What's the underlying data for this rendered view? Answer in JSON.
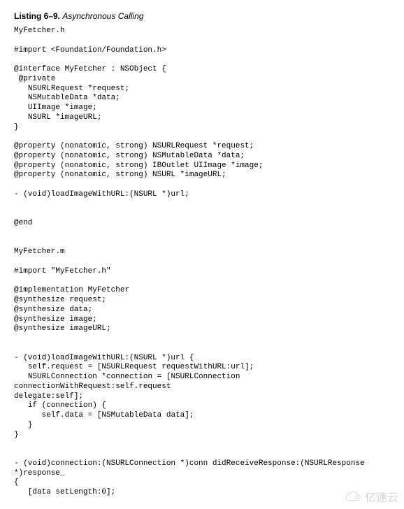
{
  "header": {
    "listing_number": "Listing 6–9.",
    "listing_title": "Asynchronous Calling"
  },
  "code_block": "MyFetcher.h\n\n#import <Foundation/Foundation.h>\n\n@interface MyFetcher : NSObject {\n @private\n   NSURLRequest *request;\n   NSMutableData *data;\n   UIImage *image;\n   NSURL *imageURL;\n}\n\n@property (nonatomic, strong) NSURLRequest *request;\n@property (nonatomic, strong) NSMutableData *data;\n@property (nonatomic, strong) IBOutlet UIImage *image;\n@property (nonatomic, strong) NSURL *imageURL;\n\n- (void)loadImageWithURL:(NSURL *)url;\n\n\n@end\n\n\nMyFetcher.m\n\n#import \"MyFetcher.h\"\n\n@implementation MyFetcher\n@synthesize request;\n@synthesize data;\n@synthesize image;\n@synthesize imageURL;\n\n\n- (void)loadImageWithURL:(NSURL *)url {\n   self.request = [NSURLRequest requestWithURL:url];\n   NSURLConnection *connection = [NSURLConnection connectionWithRequest:self.request\ndelegate:self];\n   if (connection) {\n      self.data = [NSMutableData data];\n   }\n}\n\n\n- (void)connection:(NSURLConnection *)conn didReceiveResponse:(NSURLResponse *)response_\n{\n   [data setLength:0];",
  "watermark": {
    "text": "亿速云"
  }
}
